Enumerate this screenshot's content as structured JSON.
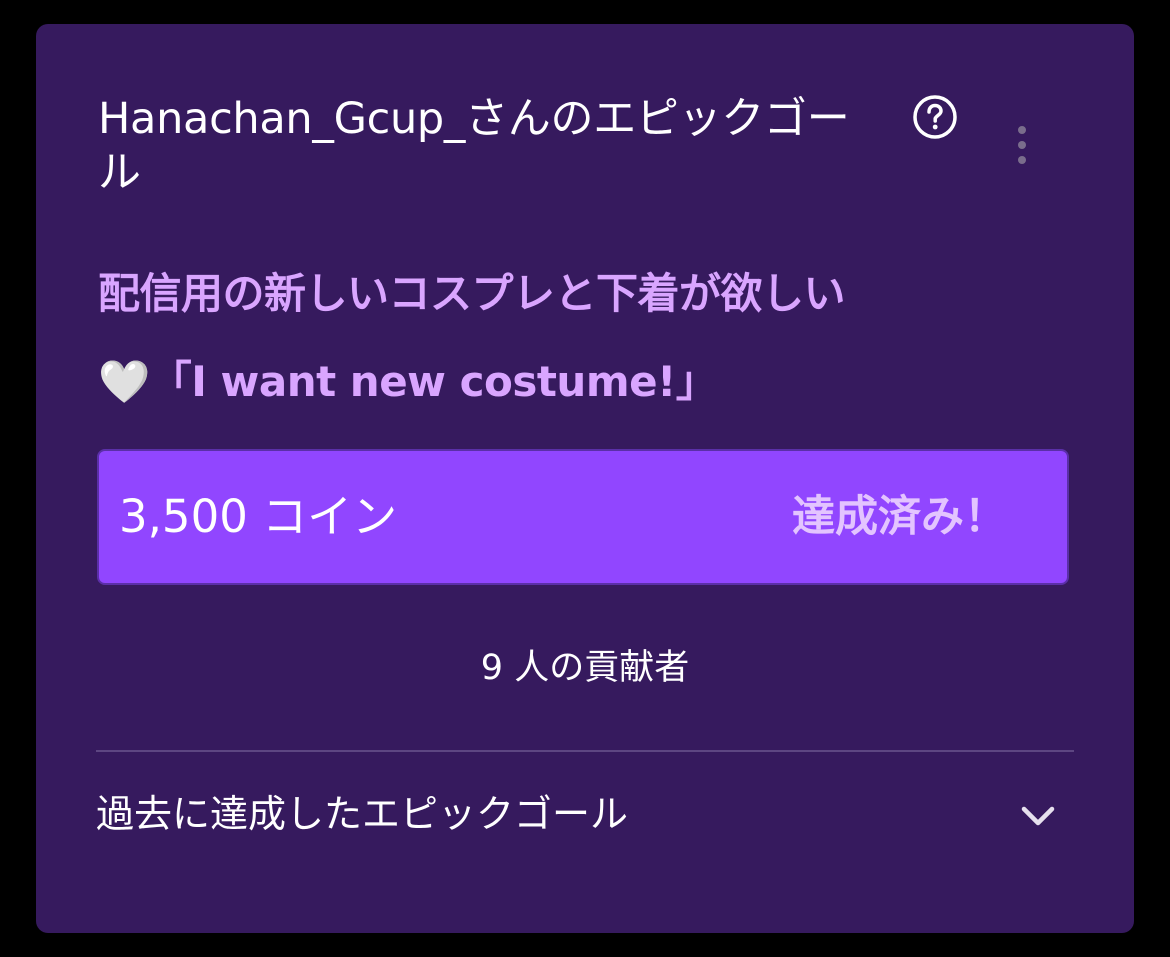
{
  "goal_card": {
    "title": "Hanachan_Gcup_さんのエピックゴール",
    "help_icon": "question-circle-icon",
    "more_icon": "vertical-ellipsis-icon",
    "description_line1": "配信用の新しいコスプレと下着が欲しい",
    "heart_emoji": "🤍",
    "description_line2": "「I want new costume!」",
    "progress": {
      "amount_label": "3,500 コイン",
      "status_label": "達成済み！",
      "fraction": 1.0
    },
    "contributors_text": "9 人の貢献者",
    "past_goals_label": "過去に達成したエピックゴール",
    "past_goals_icon": "chevron-down-icon"
  },
  "colors": {
    "page_background": "#000000",
    "card_background": "#361a5e",
    "accent_purple": "#9146ff",
    "description_text": "#d9a5ff",
    "achieved_text": "#e3c4ff"
  }
}
